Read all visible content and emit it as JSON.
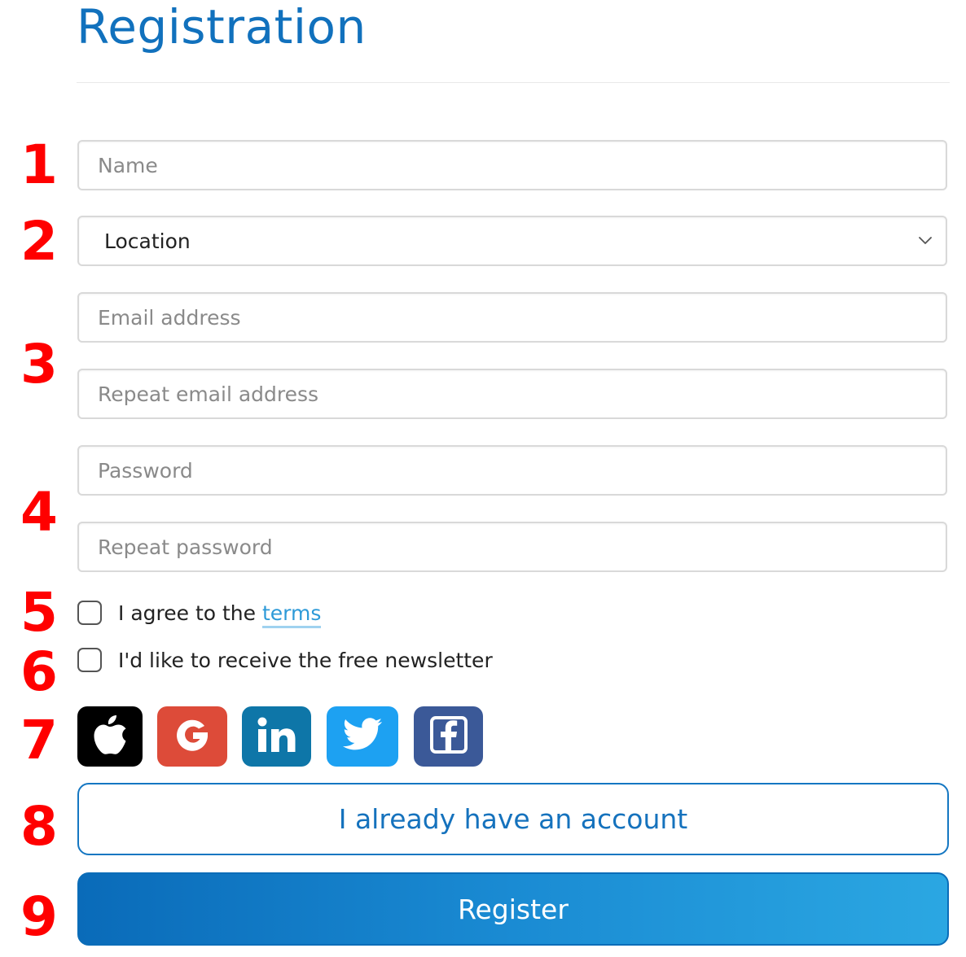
{
  "page": {
    "title": "Registration"
  },
  "markers": [
    "1",
    "2",
    "3",
    "4",
    "5",
    "6",
    "7",
    "8",
    "9"
  ],
  "form": {
    "name": {
      "placeholder": "Name",
      "value": ""
    },
    "location": {
      "selected": "Location"
    },
    "email": {
      "placeholder": "Email address",
      "value": ""
    },
    "email_repeat": {
      "placeholder": "Repeat email address",
      "value": ""
    },
    "password": {
      "placeholder": "Password",
      "value": ""
    },
    "password_repeat": {
      "placeholder": "Repeat password",
      "value": ""
    },
    "terms": {
      "prefix": "I agree to the ",
      "link": "terms",
      "checked": false
    },
    "newsletter": {
      "label": "I'd like to receive the free newsletter",
      "checked": false
    }
  },
  "social": [
    {
      "name": "apple-icon",
      "color": "#000000"
    },
    {
      "name": "google-icon",
      "color": "#dd4b39"
    },
    {
      "name": "linkedin-icon",
      "color": "#0e76a8"
    },
    {
      "name": "twitter-icon",
      "color": "#1da1f2"
    },
    {
      "name": "facebook-icon",
      "color": "#3b5998"
    }
  ],
  "actions": {
    "login_label": "I already have an account",
    "register_label": "Register"
  },
  "colors": {
    "title": "#1171bd",
    "marker": "#ff0000",
    "link": "#2d9ad8",
    "primary_start": "#0a6bb9",
    "primary_end": "#2ba7e2"
  }
}
